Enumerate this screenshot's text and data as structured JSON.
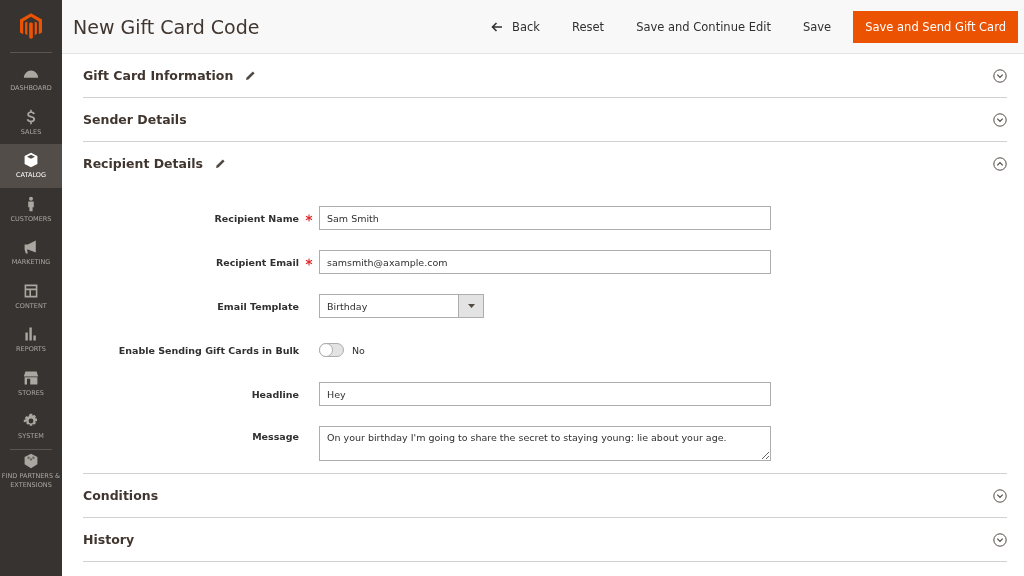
{
  "sidebar": {
    "items": [
      {
        "label": "DASHBOARD",
        "selected": false
      },
      {
        "label": "SALES",
        "selected": false
      },
      {
        "label": "CATALOG",
        "selected": true
      },
      {
        "label": "CUSTOMERS",
        "selected": false
      },
      {
        "label": "MARKETING",
        "selected": false
      },
      {
        "label": "CONTENT",
        "selected": false
      },
      {
        "label": "REPORTS",
        "selected": false
      },
      {
        "label": "STORES",
        "selected": false
      },
      {
        "label": "SYSTEM",
        "selected": false
      }
    ],
    "footer_item": {
      "label": "FIND PARTNERS & EXTENSIONS",
      "selected": false
    }
  },
  "header": {
    "title": "New Gift Card Code",
    "buttons": [
      {
        "label": "Back",
        "kind": "back"
      },
      {
        "label": "Reset",
        "kind": "plain"
      },
      {
        "label": "Save and Continue Edit",
        "kind": "plain"
      },
      {
        "label": "Save",
        "kind": "plain"
      },
      {
        "label": "Save and Send Gift Card",
        "kind": "primary"
      }
    ]
  },
  "sections": [
    {
      "title": "Gift Card Information",
      "editable": true,
      "expanded": false
    },
    {
      "title": "Sender Details",
      "editable": false,
      "expanded": false
    },
    {
      "title": "Recipient Details",
      "editable": true,
      "expanded": true,
      "fields": [
        {
          "label": "Recipient Name",
          "kind": "text",
          "required": true,
          "value": "Sam Smith"
        },
        {
          "label": "Recipient Email",
          "kind": "text",
          "required": true,
          "value": "samsmith@axample.com"
        },
        {
          "label": "Email Template",
          "kind": "select",
          "required": false,
          "value": "Birthday"
        },
        {
          "label": "Enable Sending Gift Cards in Bulk",
          "kind": "toggle",
          "required": false,
          "on": false,
          "value": "No"
        },
        {
          "label": "Headline",
          "kind": "text",
          "required": false,
          "value": "Hey"
        },
        {
          "label": "Message",
          "kind": "textarea",
          "required": false,
          "value": "On your birthday I'm going to share the secret to staying young: lie about your age."
        }
      ]
    },
    {
      "title": "Conditions",
      "editable": false,
      "expanded": false
    },
    {
      "title": "History",
      "editable": false,
      "expanded": false
    }
  ]
}
